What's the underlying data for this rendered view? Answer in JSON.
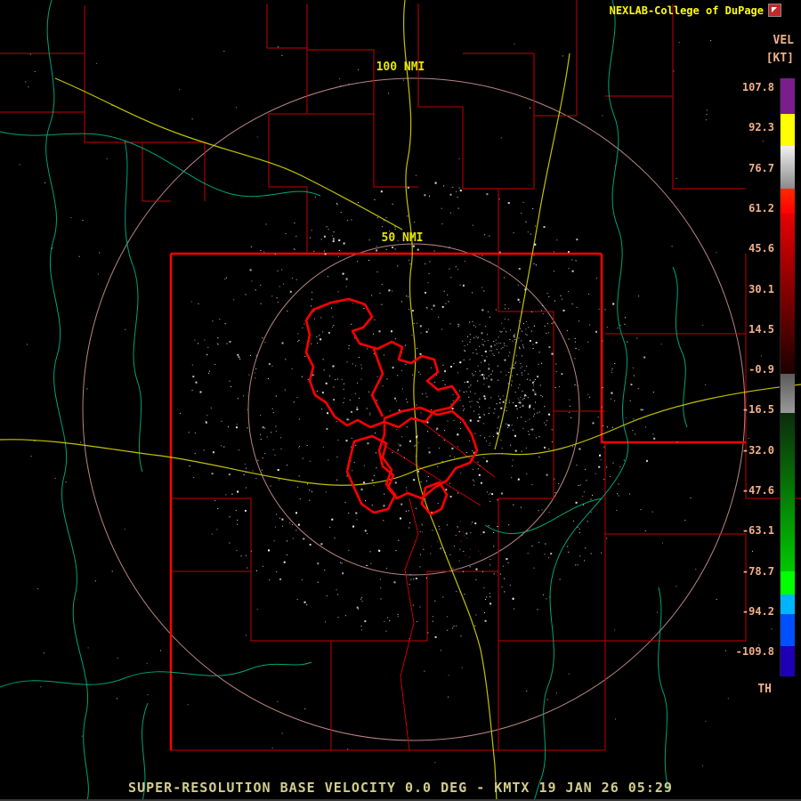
{
  "header": {
    "brand": "NEXLAB-College of DuPage"
  },
  "colorbar": {
    "unit_label": "VEL",
    "unit_sub": "[KT]",
    "ticks": [
      "107.8",
      "92.3",
      "76.7",
      "61.2",
      "45.6",
      "30.1",
      "14.5",
      "-0.9",
      "-16.5",
      "-32.0",
      "-47.6",
      "-63.1",
      "-78.7",
      "-94.2",
      "-109.8"
    ],
    "bottom_label": "TH",
    "segments": [
      {
        "from": "#7a1e8c",
        "to": "#7a1e8c",
        "h": 40
      },
      {
        "from": "#ffff00",
        "to": "#ffff00",
        "h": 36
      },
      {
        "from": "#f0f0f0",
        "to": "#8a8a8a",
        "h": 48
      },
      {
        "from": "#ff2a00",
        "to": "#ff0000",
        "h": 28
      },
      {
        "from": "#e60000",
        "to": "#1c0000",
        "h": 180
      },
      {
        "from": "#5a5a5a",
        "to": "#9a9a9a",
        "h": 44
      },
      {
        "from": "#0c2c0c",
        "to": "#00c800",
        "h": 178
      },
      {
        "from": "#00ff00",
        "to": "#00ff00",
        "h": 26
      },
      {
        "from": "#00b4ff",
        "to": "#00b4ff",
        "h": 22
      },
      {
        "from": "#0050ff",
        "to": "#0050ff",
        "h": 36
      },
      {
        "from": "#1e00b4",
        "to": "#1e00b4",
        "h": 34
      }
    ]
  },
  "map": {
    "range_rings": [
      {
        "label": "100 NMI"
      },
      {
        "label": "50 NMI"
      }
    ],
    "colors": {
      "county_line": "#c80000",
      "state_border": "#ff0000",
      "metro_boundary": "#ff0000",
      "highway": "#d8d800",
      "river": "#00bf8f",
      "range_ring": "#b98585",
      "ring_label": "#e6e600",
      "tick_label": "#f2b088",
      "status_text": "#d2cd8c",
      "brand_text": "#ffff00"
    }
  },
  "status_bar": {
    "text": "SUPER-RESOLUTION BASE VELOCITY 0.0 DEG - KMTX 19 JAN 26 05:29"
  }
}
